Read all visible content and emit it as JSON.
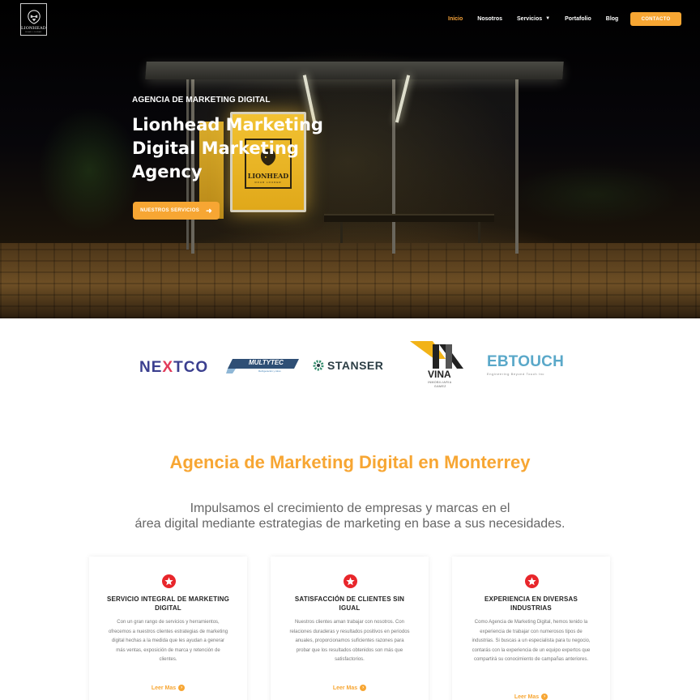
{
  "brand": {
    "logo_text": "LIONHEAD",
    "logo_subtext": "ROAR LOUDER",
    "accent_color": "#f7a633",
    "icon_color": "#e8262b"
  },
  "nav": {
    "items": [
      {
        "label": "Inicio",
        "active": true
      },
      {
        "label": "Nosotros",
        "active": false
      },
      {
        "label": "Servicios",
        "active": false,
        "has_dropdown": true
      },
      {
        "label": "Portafolio",
        "active": false
      },
      {
        "label": "Blog",
        "active": false
      }
    ],
    "contact_label": "CONTACTO"
  },
  "hero": {
    "kicker": "AGENCIA DE MARKETING DIGITAL",
    "title": "Lionhead Marketing Digital Marketing Agency",
    "cta_label": "NUESTROS SERVICIOS",
    "cta_icon": "arrow-right-icon",
    "billboard_text": "LIONHEAD",
    "billboard_subtext": "ROAR LOUDER"
  },
  "clients": {
    "nextco": {
      "pre": "NE",
      "x": "X",
      "post": "TCO"
    },
    "multytec": {
      "name": "MULTYTEC",
      "tagline": "Refrigeración y Aires"
    },
    "stanser": "STANSER",
    "vina": {
      "name": "VINA",
      "sub1": "INMOBILIARIA",
      "sub2": "GAMEZ"
    },
    "ebtouch": {
      "name": "EBTOUCH",
      "tagline": "Engineering Beyond Touch Inc"
    }
  },
  "intro": {
    "title": "Agencia de Marketing Digital en Monterrey",
    "subtitle_line1": "Impulsamos el crecimiento de empresas y marcas en el",
    "subtitle_line2": "área digital mediante estrategias de marketing en base a sus necesidades."
  },
  "cards": [
    {
      "icon": "star-icon",
      "title": "SERVICIO INTEGRAL DE MARKETING DIGITAL",
      "text": "Con un gran rango de servicios y herramientos, ofrecemos a nuestros clientes estrategias de marketing digital hechas a la medida que les ayudan a generar más ventas, exposición de marca y retención de clientes.",
      "link": "Leer Mas"
    },
    {
      "icon": "star-icon",
      "title": "SATISFACCIÓN DE CLIENTES SIN IGUAL",
      "text": "Nuestros clientes aman trabajar con nosotros. Con relaciones duraderas y resultados positivos en periodos anuales, proporcionamos suficientes razones para probar que los resultados obtenidos son más que satisfactorios.",
      "link": "Leer Mas"
    },
    {
      "icon": "star-icon",
      "title": "EXPERIENCIA EN DIVERSAS INDUSTRIAS",
      "text": "Como Agencia de Marketing Digital, hemos tenido la experiencia de trabajar con numerosos tipos de industrias. Si buscas a un especialista para tu negocio, contarás con la experiencia de un equipo expertos que compartirá su conocimiento de campañas anteriores.",
      "link": "Leer Mas"
    }
  ]
}
